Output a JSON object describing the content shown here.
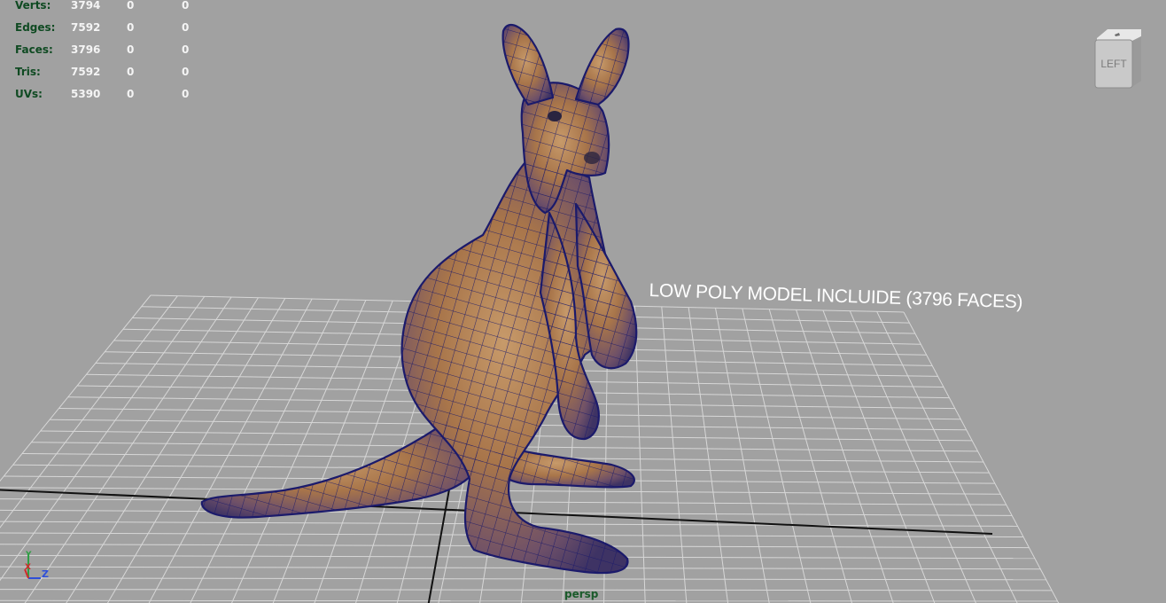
{
  "stats": [
    {
      "label": "Verts:",
      "values": [
        "3794",
        "0",
        "0"
      ]
    },
    {
      "label": "Edges:",
      "values": [
        "7592",
        "0",
        "0"
      ]
    },
    {
      "label": "Faces:",
      "values": [
        "3796",
        "0",
        "0"
      ]
    },
    {
      "label": "Tris:",
      "values": [
        "7592",
        "0",
        "0"
      ]
    },
    {
      "label": "UVs:",
      "values": [
        "5390",
        "0",
        "0"
      ]
    }
  ],
  "viewcube": {
    "face_label": "LEFT",
    "icon": "viewcube-icon"
  },
  "caption": "LOW POLY MODEL INCLUIDE (3796 FACES)",
  "camera_label": "persp",
  "axis": {
    "y": "Y",
    "x": "X",
    "z": "Z",
    "icon": "axis-gizmo-icon"
  },
  "colors": {
    "background": "#a1a1a1",
    "grid": "#d7d7d7",
    "wireframe": "#1b1a6b",
    "model": "#b07a4a",
    "stat_label": "#0f4a22",
    "stat_value": "#f4f4f4"
  }
}
